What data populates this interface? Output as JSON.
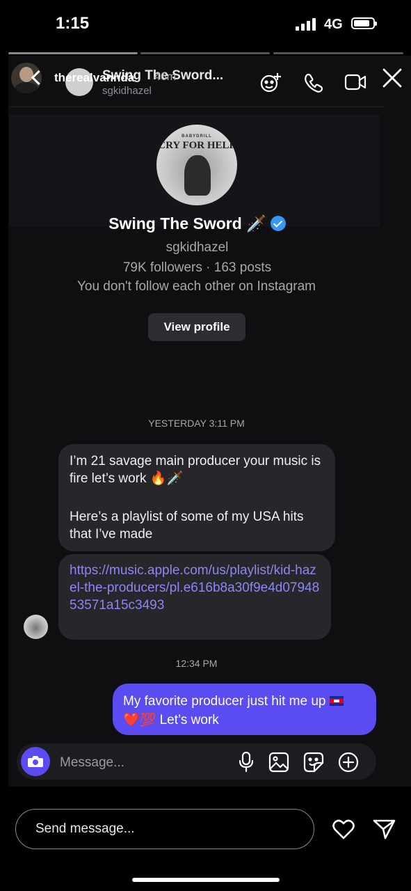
{
  "status_bar": {
    "time": "1:15",
    "network": "4G"
  },
  "story": {
    "poster_username": "therealvannda",
    "age": "46m"
  },
  "chat": {
    "title": "Swing The Sword...",
    "subtitle": "sgkidhazel"
  },
  "profile": {
    "album_small_text": "BABYDRILL",
    "album_title": "CRY FOR HELP",
    "name": "Swing The Sword 🗡️",
    "username": "sgkidhazel",
    "stats": "79K followers · 163 posts",
    "follow_status": "You don't follow each other on Instagram",
    "view_profile_label": "View profile"
  },
  "messages": {
    "divider_1": "YESTERDAY 3:11 PM",
    "incoming_1_line1": "I’m 21 savage main producer your music is fire let’s work 🔥🗡️",
    "incoming_1_line2": "Here’s a playlist of some of my USA hits that I’ve made",
    "incoming_2_link": "https://music.apple.com/us/playlist/kid-hazel-the-producers/pl.e616b8a30f9e4d0794853571a15c3493",
    "divider_2": "12:34 PM",
    "outgoing_1_part1": "My favorite producer just hit me up",
    "outgoing_1_part2": "❤️💯 Let’s work"
  },
  "composer": {
    "placeholder": "Message..."
  },
  "reply": {
    "placeholder": "Send message..."
  },
  "colors": {
    "accent": "#5a4cf0",
    "link": "#8d86f4",
    "verified": "#3897f0"
  }
}
